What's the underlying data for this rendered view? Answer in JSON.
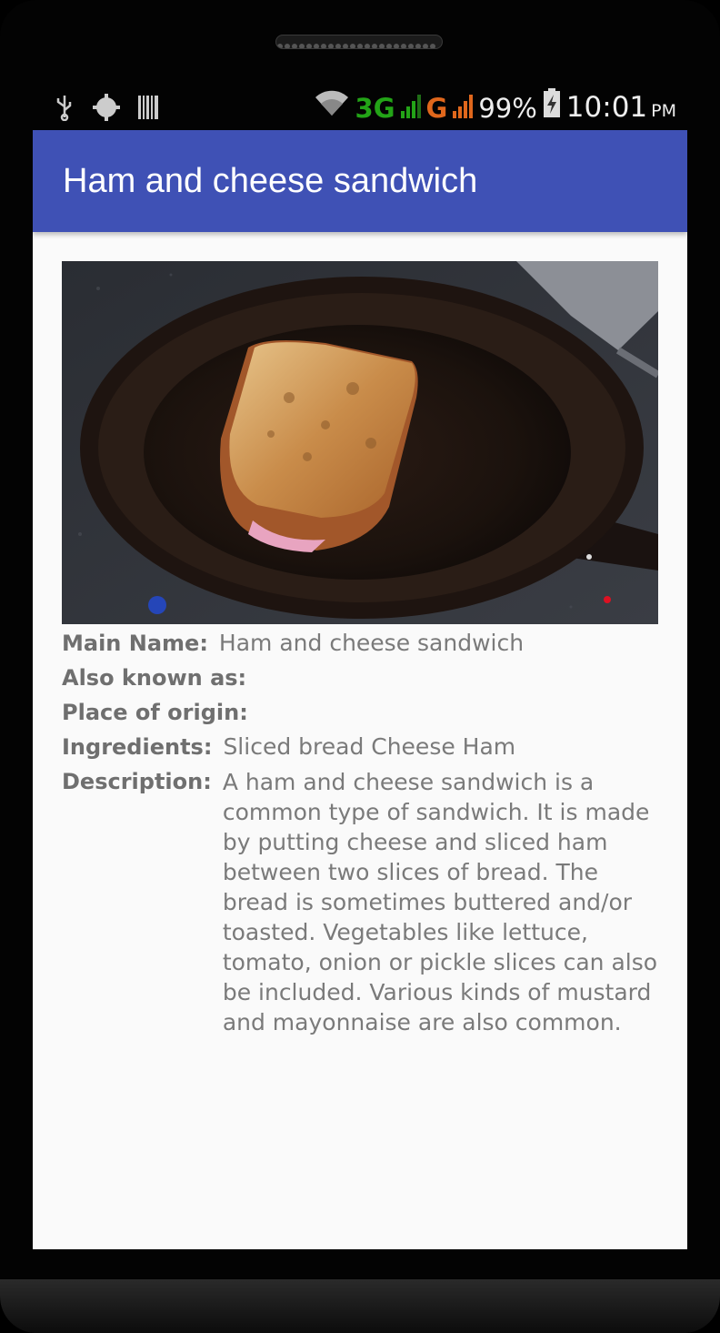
{
  "status_bar": {
    "network_3g": "3G",
    "network_g": "G",
    "battery": "99%",
    "time": "10:01",
    "ampm": "PM",
    "colors": {
      "net_3g": "#23a417",
      "net_g": "#e0671c"
    }
  },
  "app_bar": {
    "title": "Ham and cheese sandwich",
    "color": "#3f51b5"
  },
  "details": {
    "main_name_label": "Main Name:",
    "main_name": "Ham and cheese sandwich",
    "aka_label": "Also known as:",
    "aka": "",
    "origin_label": "Place of origin:",
    "origin": "",
    "ingredients_label": "Ingredients:",
    "ingredients": "Sliced bread Cheese Ham",
    "description_label": "Description:",
    "description": "A ham and cheese sandwich is a common type of sandwich. It is made by putting cheese and sliced ham between two slices of bread. The bread is sometimes buttered and/or toasted. Vegetables like lettuce, tomato, onion or pickle slices can also be included. Various kinds of mustard and mayonnaise are also common."
  }
}
